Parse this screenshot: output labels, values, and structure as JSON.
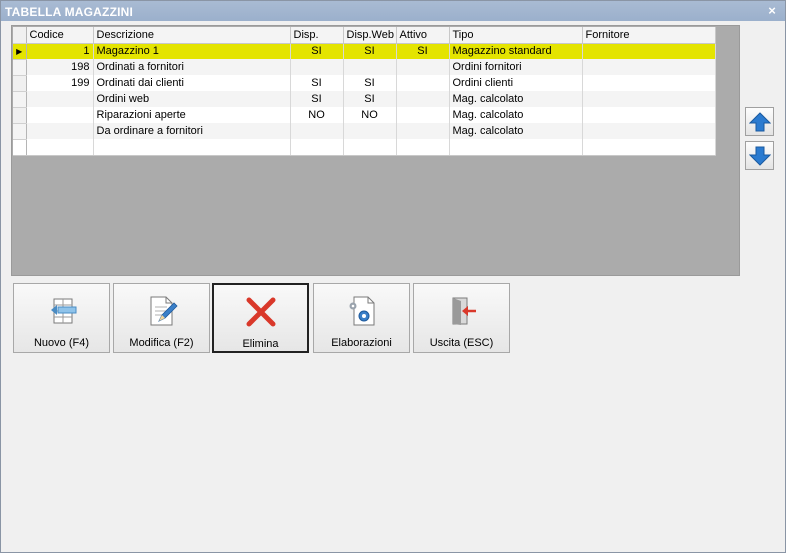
{
  "window": {
    "title": "TABELLA MAGAZZINI",
    "close_label": "×"
  },
  "grid": {
    "columns": [
      "Codice",
      "Descrizione",
      "Disp.",
      "Disp.Web",
      "Attivo",
      "Tipo",
      "Fornitore"
    ],
    "rows": [
      {
        "codice": "1",
        "descrizione": "Magazzino 1",
        "disp": "SI",
        "disp_web": "SI",
        "attivo": "SI",
        "tipo": "Magazzino standard",
        "fornitore": ""
      },
      {
        "codice": "198",
        "descrizione": "Ordinati a fornitori",
        "disp": "",
        "disp_web": "",
        "attivo": "",
        "tipo": "Ordini fornitori",
        "fornitore": ""
      },
      {
        "codice": "199",
        "descrizione": "Ordinati dai clienti",
        "disp": "SI",
        "disp_web": "SI",
        "attivo": "",
        "tipo": "Ordini clienti",
        "fornitore": ""
      },
      {
        "codice": "",
        "descrizione": "Ordini web",
        "disp": "SI",
        "disp_web": "SI",
        "attivo": "",
        "tipo": "Mag. calcolato",
        "fornitore": ""
      },
      {
        "codice": "",
        "descrizione": "Riparazioni aperte",
        "disp": "NO",
        "disp_web": "NO",
        "attivo": "",
        "tipo": "Mag. calcolato",
        "fornitore": ""
      },
      {
        "codice": "",
        "descrizione": "Da ordinare a fornitori",
        "disp": "",
        "disp_web": "",
        "attivo": "",
        "tipo": "Mag. calcolato",
        "fornitore": ""
      }
    ],
    "selected_indicator": "▶"
  },
  "side_buttons": {
    "up_icon": "arrow-up-icon",
    "down_icon": "arrow-down-icon"
  },
  "toolbar": {
    "new_label": "Nuovo (F4)",
    "edit_label": "Modifica (F2)",
    "delete_label": "Elimina",
    "process_label": "Elaborazioni",
    "exit_label": "Uscita (ESC)"
  },
  "colors": {
    "selected_row": "#e4e400",
    "titlebar": "#a3b6cf",
    "delete_red": "#d9382a",
    "arrow_blue": "#2b7bd0"
  }
}
